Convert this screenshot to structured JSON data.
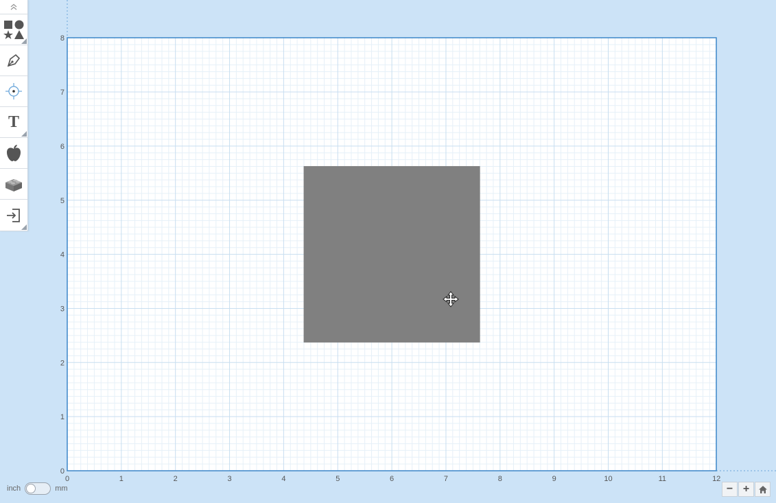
{
  "canvas": {
    "x_ticks": [
      "0",
      "1",
      "2",
      "3",
      "4",
      "5",
      "6",
      "7",
      "8",
      "9",
      "10",
      "11",
      "12"
    ],
    "y_ticks": [
      "0",
      "1",
      "2",
      "3",
      "4",
      "5",
      "6",
      "7",
      "8"
    ],
    "shape": {
      "x": 4.37,
      "y": 2.37,
      "width": 3.26,
      "height": 3.26,
      "color": "#808080"
    }
  },
  "units": {
    "left": "inch",
    "right": "mm",
    "selected": "inch"
  },
  "toolbar": {
    "icons": [
      "chevron-up-icon",
      "shapes-icon",
      "pen-icon",
      "target-icon",
      "text-icon",
      "apple-icon",
      "brick-icon",
      "import-icon"
    ],
    "text_tool_glyph": "T"
  },
  "zoom": {
    "out": "−",
    "in": "+",
    "home": "home-icon"
  },
  "colors": {
    "background": "#cce3f7",
    "grid_major": "#c8def0",
    "grid_minor": "#e6f0f8",
    "border": "#3b86c8"
  }
}
